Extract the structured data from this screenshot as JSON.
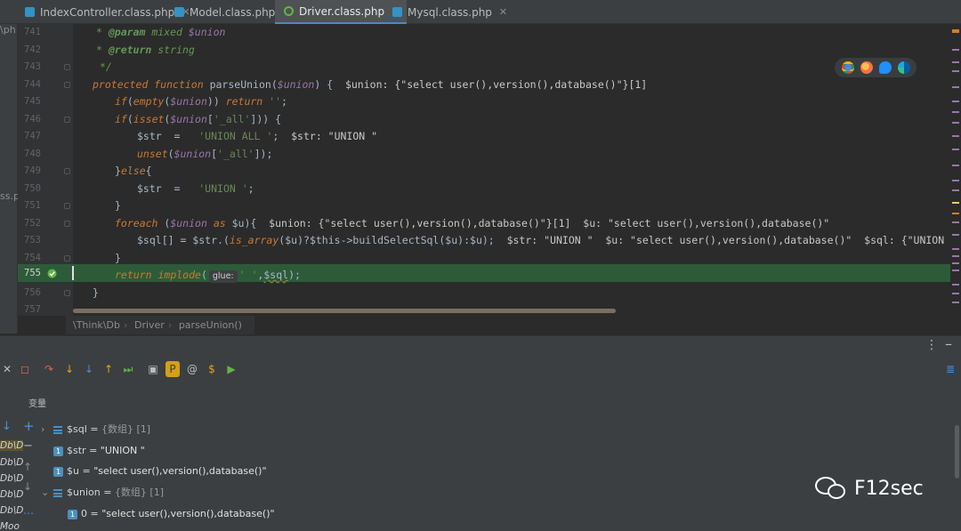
{
  "tabs": [
    {
      "label": "IndexController.class.php",
      "active": false
    },
    {
      "label": "Model.class.php",
      "active": false
    },
    {
      "label": "Driver.class.php",
      "active": true
    },
    {
      "label": "Mysql.class.php",
      "active": false
    }
  ],
  "tab_close_glyph": "✕",
  "left_stub": {
    "top": "\\ph",
    "mid": "ss.pl"
  },
  "lines": [
    {
      "num": "741"
    },
    {
      "num": "742"
    },
    {
      "num": "743"
    },
    {
      "num": "744"
    },
    {
      "num": "745"
    },
    {
      "num": "746"
    },
    {
      "num": "747"
    },
    {
      "num": "748"
    },
    {
      "num": "749"
    },
    {
      "num": "750"
    },
    {
      "num": "751"
    },
    {
      "num": "752"
    },
    {
      "num": "753"
    },
    {
      "num": "754"
    },
    {
      "num": "755"
    },
    {
      "num": "756"
    },
    {
      "num": "757"
    }
  ],
  "code": {
    "l741_star": "* ",
    "l741_tag": "@param",
    "l741_type": " mixed ",
    "l741_var": "$union",
    "l742_star": "* ",
    "l742_tag": "@return",
    "l742_type": " string",
    "l743": "*/",
    "l744_kw1": "protected",
    "l744_kw2": "function",
    "l744_fn": "parseUnion",
    "l744_p": "$union",
    "l744_tail": ") {",
    "l744_inline": "$union: {\"select user(),version(),database()\"}[1]",
    "l745_kw": "if",
    "l745_empty": "empty",
    "l745_var": "$union",
    "l745_ret": "return",
    "l745_str": "''",
    "l746_kw": "if",
    "l746_isset": "isset",
    "l746_var": "$union",
    "l746_key": "'_all'",
    "l747_var": "$str",
    "l747_str": "'UNION ALL '",
    "l747_inline": "$str: \"UNION \"",
    "l748_fn": "unset",
    "l748_var": "$union",
    "l748_key": "'_all'",
    "l749_kw": "else",
    "l750_var": "$str",
    "l750_str": "'UNION '",
    "l751": "}",
    "l752_kw": "foreach",
    "l752_var": "$union",
    "l752_as": "as",
    "l752_u": "$u",
    "l752_inline": "$union: {\"select user(),version(),database()\"}[1]  $u: \"select user(),version(),database()\"",
    "l753_sql": "$sql",
    "l753_str": "$str",
    "l753_isarr": "is_array",
    "l753_u": "$u",
    "l753_this": "$this",
    "l753_fn": "buildSelectSql",
    "l753_inline": "$str: \"UNION \"  $u: \"select user(),version(),database()\"  $sql: {\"UNION select user(),version(),database()\"}",
    "l754": "}",
    "l755_kw": "return",
    "l755_fn": "implode",
    "l755_glue": "glue:",
    "l755_str": "' '",
    "l755_var": "$sql",
    "l756": "}"
  },
  "breadcrumb": [
    "\\Think\\Db",
    "Driver",
    "parseUnion()"
  ],
  "debug": {
    "vars_label": "变量",
    "vars": [
      {
        "name": "$sql",
        "op": " = ",
        "type": "{数组} [1]",
        "value": ""
      },
      {
        "name": "$str",
        "op": " = ",
        "type": "",
        "value": "\"UNION \""
      },
      {
        "name": "$u",
        "op": " = ",
        "type": "",
        "value": "\"select user(),version(),database()\""
      },
      {
        "name": "$union",
        "op": " = ",
        "type": "{数组} [1]",
        "value": ""
      },
      {
        "name": "0",
        "op": " = ",
        "type": "",
        "value": "\"select user(),version(),database()\""
      }
    ],
    "frames": [
      "Db\\D",
      "Db\\D",
      "Db\\D",
      "Db\\D",
      "Db\\D",
      "Moo"
    ],
    "badge_letter": "1"
  },
  "watermark": "F12sec",
  "colors": {
    "accent": "#4a88c7",
    "exec_line": "#2d5b3a",
    "keyword": "#cc7832",
    "string": "#6a8759",
    "var": "#9876aa"
  }
}
